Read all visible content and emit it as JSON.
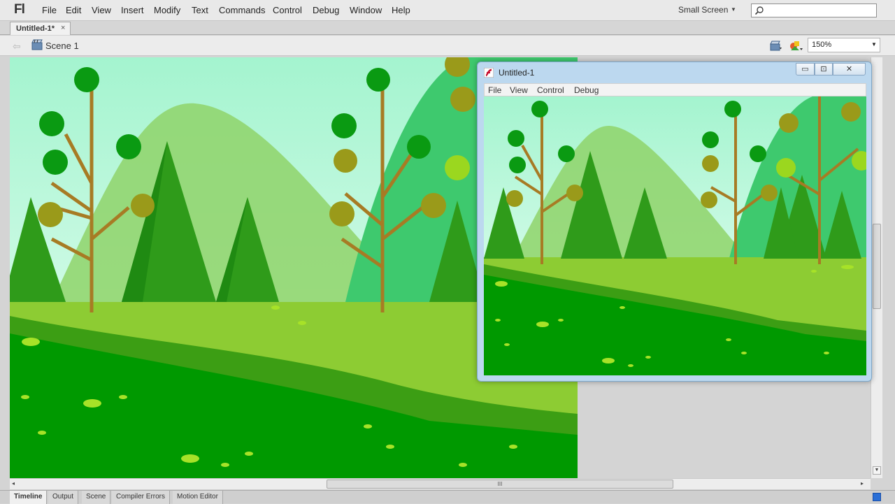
{
  "app": {
    "logo": "Fl"
  },
  "menu": {
    "items": [
      "File",
      "Edit",
      "View",
      "Insert",
      "Modify",
      "Text",
      "Commands",
      "Control",
      "Debug",
      "Window",
      "Help"
    ]
  },
  "workspace": {
    "label": "Small Screen"
  },
  "search": {
    "value": ""
  },
  "document_tab": {
    "label": "Untitled-1*",
    "close": "×"
  },
  "edit_bar": {
    "back": "⇦",
    "scene": "Scene 1",
    "zoom": "150%"
  },
  "player": {
    "title": "Untitled-1",
    "menu": [
      "File",
      "View",
      "Control",
      "Debug"
    ],
    "buttons": {
      "minimize": "▭",
      "maximize": "⊡",
      "close": "✕"
    }
  },
  "scrollbars": {
    "grip": "III",
    "left": "◂",
    "right": "▸",
    "down": "▼"
  },
  "bottom_tabs": [
    "Timeline",
    "Output",
    "Scene",
    "Compiler Errors",
    "Motion Editor"
  ],
  "icons": [
    "search-icon",
    "scene-icon",
    "edit-scene-icon",
    "edit-symbol-icon",
    "player-flash-icon"
  ],
  "colors": {
    "sky": "#a8f0d0",
    "hill": "#8fcf5e",
    "grass": "#009900",
    "light_grass": "#8dc63f",
    "tree": "#2e9a1a",
    "trunk": "#a07820"
  }
}
